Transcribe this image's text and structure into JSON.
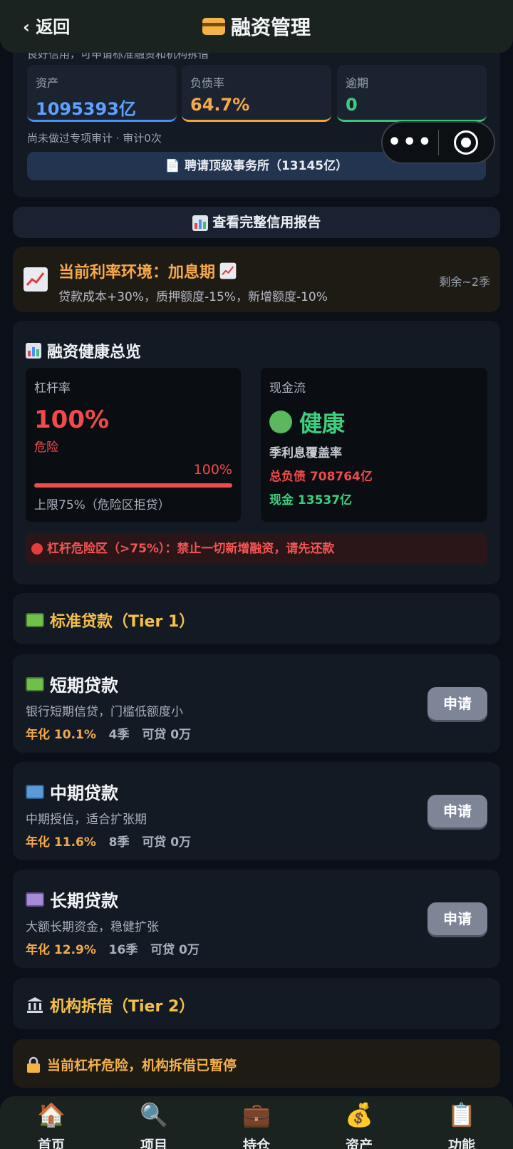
{
  "header": {
    "back_label": "返回",
    "title": "融资管理"
  },
  "credit": {
    "clipped_text": "良好信用，可申请标准融资和机构拆借",
    "stats": [
      {
        "label": "资产",
        "value": "1095393亿",
        "color": "#5ea1ff"
      },
      {
        "label": "负债率",
        "value": "64.7%",
        "color": "#f5a94a"
      },
      {
        "label": "逾期",
        "value": "0",
        "color": "#3ecf7e"
      }
    ],
    "audit_note": "尚未做过专项审计 · 审计0次",
    "hire_button": "📄 聘请顶级事务所（13145亿）"
  },
  "report_button": "查看完整信用报告",
  "rate_env": {
    "title": "当前利率环境：加息期",
    "desc": "贷款成本+30%，质押额度-15%，新增额度-10%",
    "remain": "剩余~2季"
  },
  "health": {
    "title": "融资健康总览",
    "leverage": {
      "label": "杠杆率",
      "value": "100%",
      "risk": "危险",
      "bar_pct_label": "100%",
      "bar_fraction": 1.0,
      "limit": "上限75%（危险区拒贷）"
    },
    "cashflow": {
      "label": "现金流",
      "status": "健康",
      "sub": "季利息覆盖率",
      "debt": "总负债 708764亿",
      "cash": "现金 13537亿"
    },
    "alert": "杠杆危险区（>75%）：禁止一切新增融资，请先还款"
  },
  "tier1": {
    "title": "标准贷款（Tier 1）"
  },
  "loans": [
    {
      "title": "短期贷款",
      "desc": "银行短期信贷，门槛低额度小",
      "rate": "年化 10.1%",
      "term": "4季",
      "avail": "可贷 0万",
      "apply": "申请"
    },
    {
      "title": "中期贷款",
      "desc": "中期授信，适合扩张期",
      "rate": "年化 11.6%",
      "term": "8季",
      "avail": "可贷 0万",
      "apply": "申请"
    },
    {
      "title": "长期贷款",
      "desc": "大额长期资金，稳健扩张",
      "rate": "年化 12.9%",
      "term": "16季",
      "avail": "可贷 0万",
      "apply": "申请"
    }
  ],
  "tier2": {
    "title": "机构拆借（Tier 2）"
  },
  "locked_note": "当前杠杆危险，机构拆借已暂停",
  "tabs": [
    {
      "icon": "🏠",
      "label": "首页"
    },
    {
      "icon": "🔍",
      "label": "项目"
    },
    {
      "icon": "💼",
      "label": "持仓"
    },
    {
      "icon": "💰",
      "label": "资产"
    },
    {
      "icon": "📋",
      "label": "功能"
    }
  ]
}
